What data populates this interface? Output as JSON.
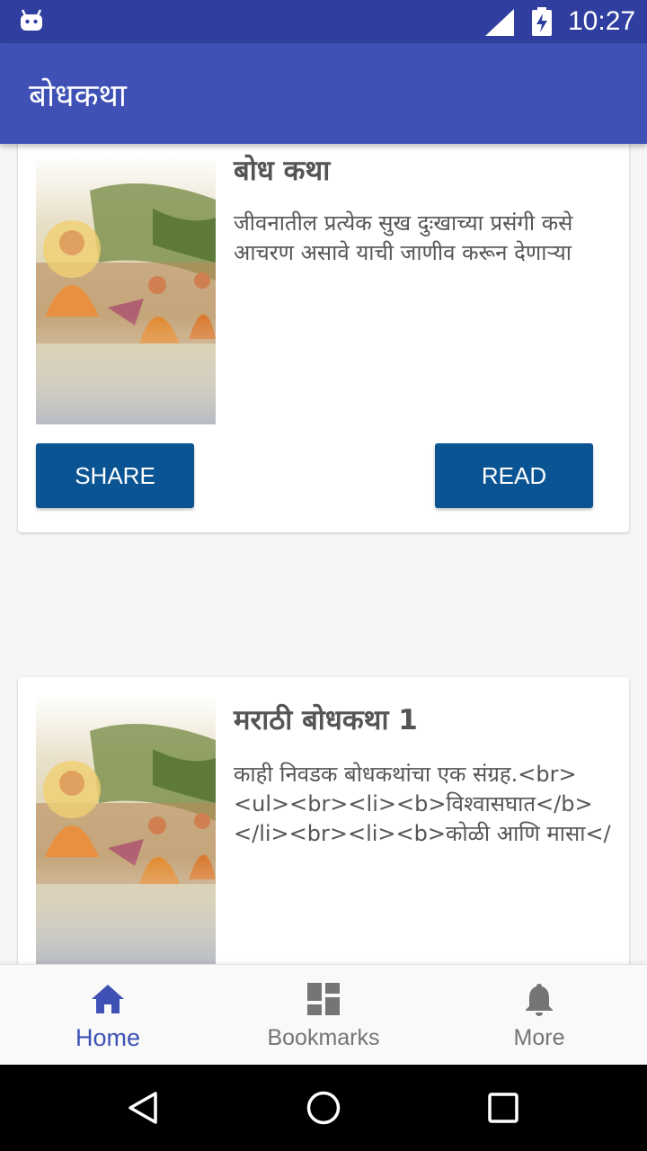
{
  "status_bar": {
    "time": "10:27"
  },
  "app_bar": {
    "title": "बोधकथा"
  },
  "cards": [
    {
      "title": "बोध कथा",
      "description": "जीवनातील प्रत्येक सुख दुःखाच्या प्रसंगी कसे आचरण असावे याची जाणीव करून देणाऱ्या",
      "share_label": "SHARE",
      "read_label": "READ"
    },
    {
      "title": "मराठी बोधकथा 1",
      "description": "काही निवडक बोधकथांचा एक संग्रह.<br><ul><br><li><b>विश्वासघात</b></li><br><li><b>कोळी आणि मासा</"
    }
  ],
  "bottom_nav": [
    {
      "label": "Home",
      "icon": "home-icon",
      "active": true
    },
    {
      "label": "Bookmarks",
      "icon": "bookmarks-icon",
      "active": false
    },
    {
      "label": "More",
      "icon": "bell-icon",
      "active": false
    }
  ],
  "colors": {
    "status_bar": "#303f9f",
    "app_bar": "#3f51b5",
    "button": "#0b5493",
    "active_nav": "#3f51b5"
  }
}
